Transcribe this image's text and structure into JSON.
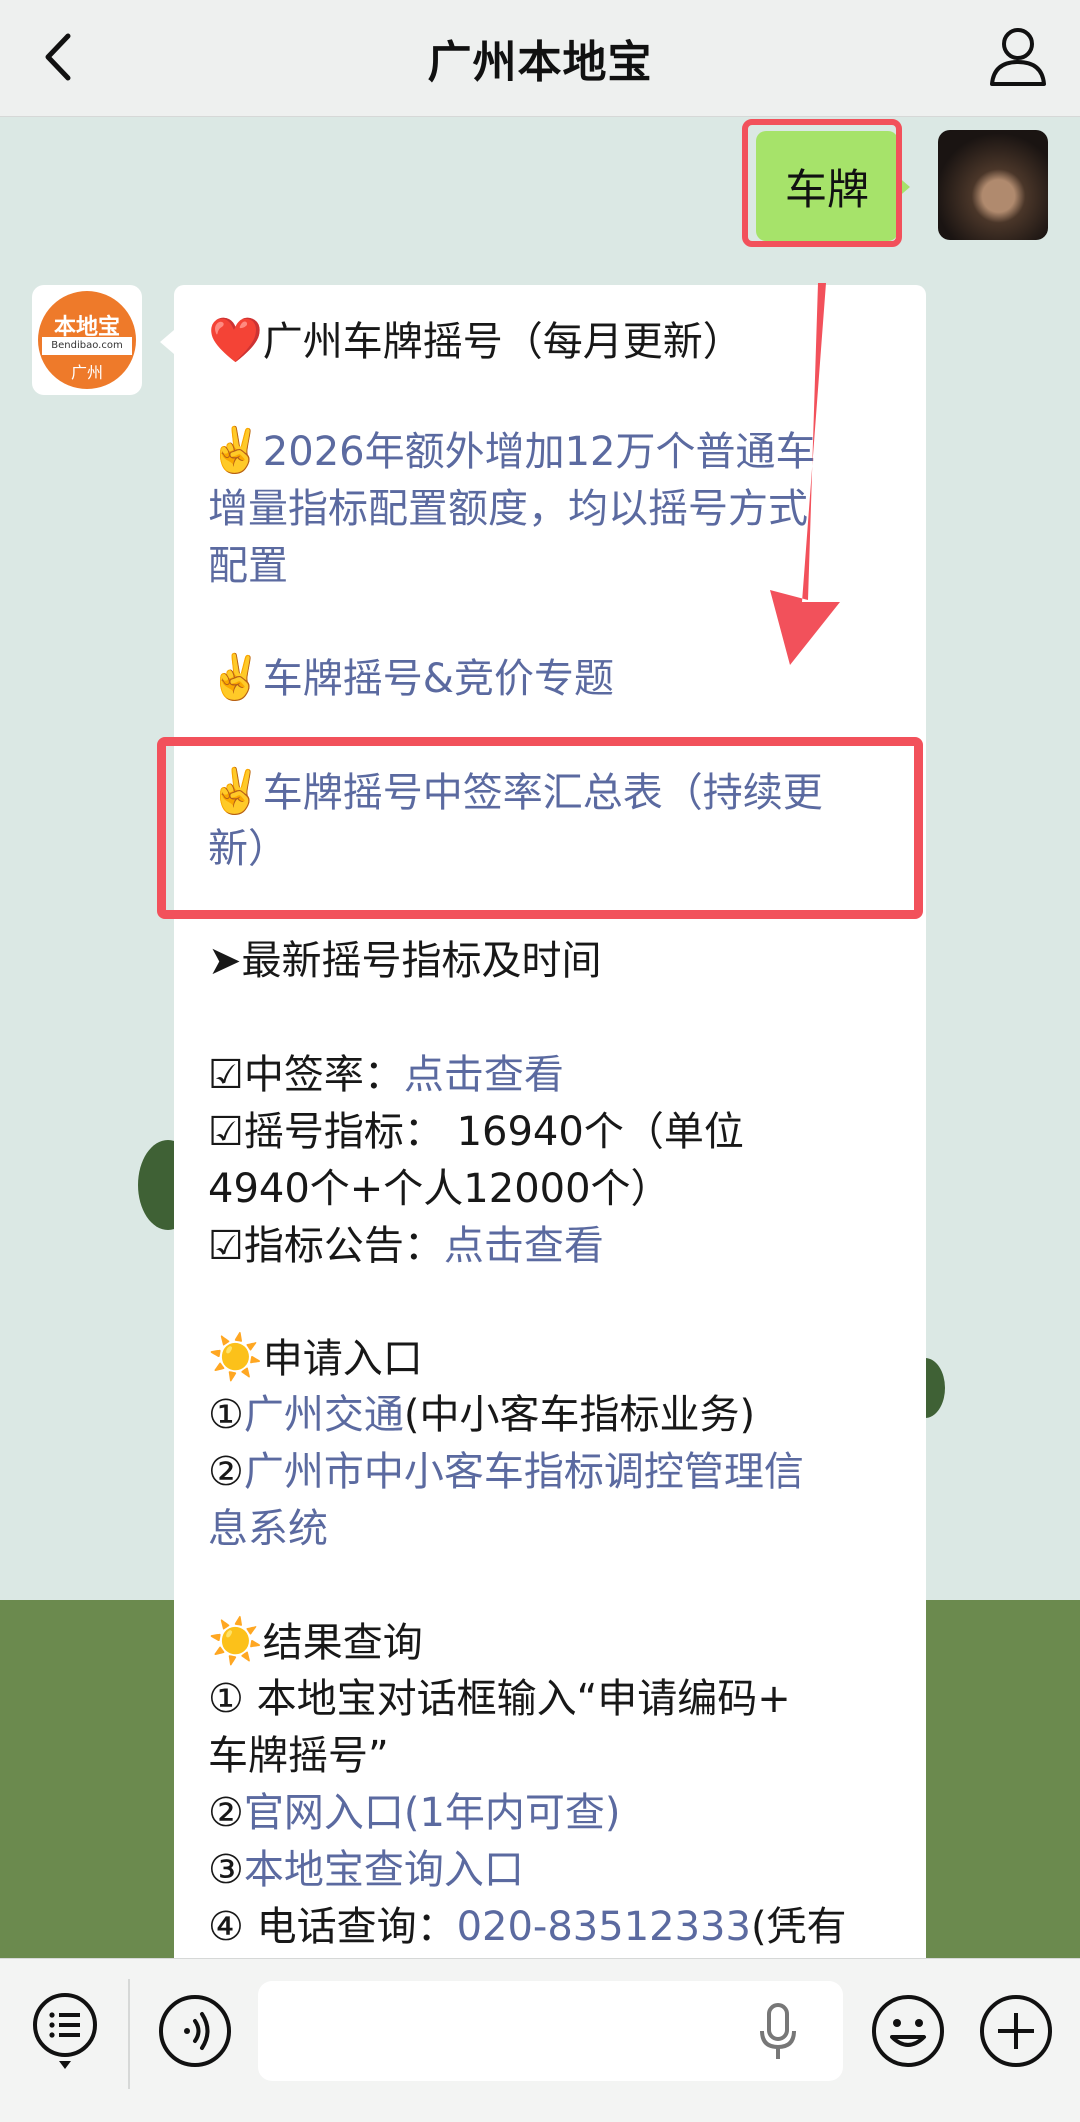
{
  "header": {
    "title": "广州本地宝"
  },
  "sent": {
    "text": "车牌"
  },
  "logo": {
    "top": "本地宝",
    "mid": "Bendibao.com",
    "bottom": "广州"
  },
  "message": {
    "l1": "广州车牌摇号（每月更新）",
    "l2": "2026年额外增加12万个普通车",
    "l3": "增量指标配置额度，均以摇号方式",
    "l4": "配置",
    "l5": "车牌摇号&竞价专题",
    "l6": "车牌摇号中签率汇总表（持续更",
    "l7": "新）",
    "l8": "➤最新摇号指标及时间",
    "l9_prefix": "☑中签率：",
    "l9_link": "点击查看",
    "l10": "☑摇号指标：  16940个（单位",
    "l11": "4940个+个人12000个）",
    "l12_prefix": "☑指标公告：",
    "l12_link": "点击查看",
    "l13": "申请入口",
    "l14_num": "①",
    "l14_link": "广州交通",
    "l14_rest": "(中小客车指标业务)",
    "l15_num": "②",
    "l15_link": "广州市中小客车指标调控管理信",
    "l16_link": "息系统",
    "l17": "结果查询",
    "l18": "① 本地宝对话框输入“申请编码+",
    "l19": "车牌摇号”",
    "l20_num": "②",
    "l20_link": "官网入口(1年内可查)",
    "l21_num": "③",
    "l21_link": "本地宝查询入口",
    "l22_prefix": "④ 电话查询：",
    "l22_link": "020-83512333",
    "l22_rest": "(凭有"
  },
  "emoji": {
    "heart": "❤️",
    "victory": "✌️",
    "sun": "☀️"
  },
  "colors": {
    "link": "#5b6aa0",
    "highlight": "#f2515b",
    "sent_bubble": "#a6e36a"
  },
  "icons": [
    "back-icon",
    "profile-icon",
    "menu-icon",
    "voice-icon",
    "mic-icon",
    "emoji-icon",
    "plus-icon"
  ]
}
